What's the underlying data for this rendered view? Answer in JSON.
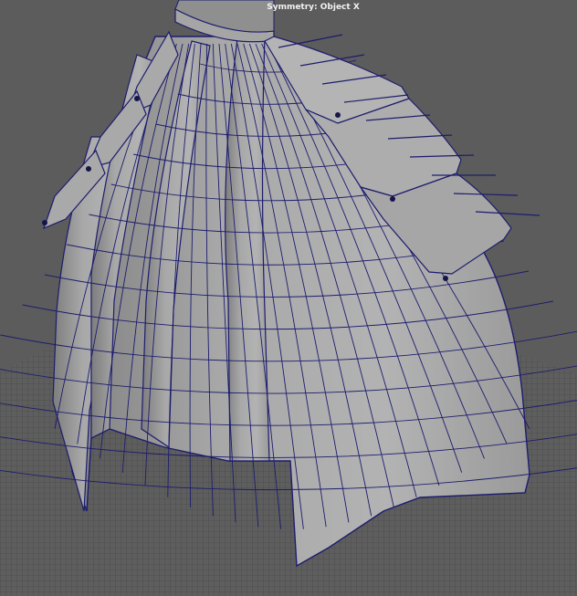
{
  "viewport": {
    "status_text": "Symmetry: Object X",
    "wireframe_color": "#1c1c6e",
    "surface_color": "#9b9b9b",
    "background_color": "#5c5c5c",
    "grid_color": "#4a4a4a"
  }
}
